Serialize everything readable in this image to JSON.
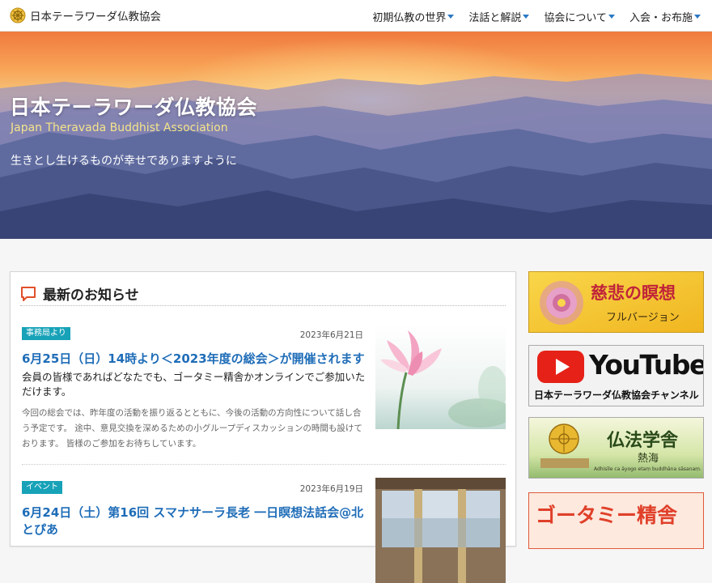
{
  "brand": {
    "name": "日本テーラワーダ仏教協会"
  },
  "nav": [
    {
      "label": "初期仏教の世界"
    },
    {
      "label": "法話と解説"
    },
    {
      "label": "協会について"
    },
    {
      "label": "入会・お布施"
    }
  ],
  "hero": {
    "title": "日本テーラワーダ仏教協会",
    "subtitle": "Japan Theravada Buddhist Association",
    "tagline": "生きとし生けるものが幸せでありますように"
  },
  "news": {
    "heading": "最新のお知らせ",
    "posts": [
      {
        "badge": "事務局より",
        "date": "2023年6月21日",
        "title": "6月25日（日）14時より＜2023年度の総会＞が開催されます",
        "lead": "会員の皆様であればどなたでも、ゴータミー精舎かオンラインでご参加いただけます。",
        "body": "今回の総会では、昨年度の活動を振り返るとともに、今後の活動の方向性について話し合う予定です。 途中、意見交換を深めるための小グループディスカッションの時間も設けております。 皆様のご参加をお待ちしています。",
        "thumb": "lotus-photo"
      },
      {
        "badge": "イベント",
        "date": "2023年6月19日",
        "title": "6月24日（土）第16回 スマナサーラ長老 一日瞑想法話会@北とぴあ",
        "thumb": "hall-photo"
      }
    ]
  },
  "sidebar": {
    "banners": [
      {
        "title": "慈悲の瞑想",
        "subtitle": "フルバージョン"
      },
      {
        "title": "YouTube",
        "subtitle": "日本テーラワーダ仏教協会チャンネル"
      },
      {
        "title": "仏法学舎",
        "subtitle": "熱海",
        "caption": "Adhisīle ca āyogo etaṃ buddhāna sāsanaṃ."
      },
      {
        "title": "ゴータミー精舎"
      }
    ]
  },
  "colors": {
    "accent": "#1f6db8",
    "badge": "#17a2b8",
    "caret": "#2b79c2",
    "hero_sub": "#f4e48a"
  }
}
